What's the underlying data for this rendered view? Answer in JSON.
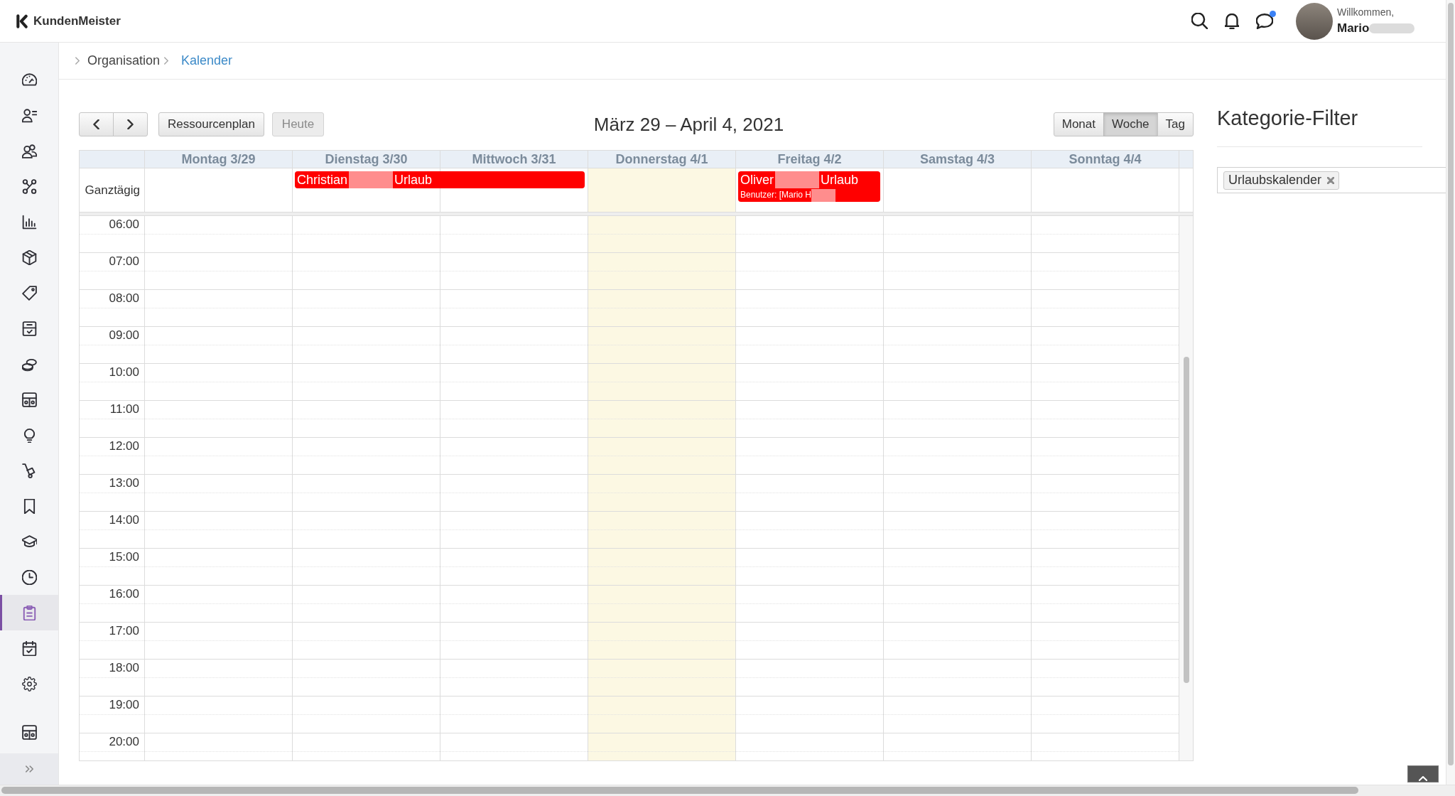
{
  "header": {
    "logo_text": "KundenMeister",
    "chat_unread": true,
    "user": {
      "greeting": "Willkommen,",
      "name": "Mario",
      "name_redacted": true
    }
  },
  "sidebar": {
    "items": [
      {
        "selected": false
      },
      {
        "selected": false
      },
      {
        "selected": false
      },
      {
        "selected": false
      },
      {
        "selected": false
      },
      {
        "selected": false
      },
      {
        "selected": false
      },
      {
        "selected": false
      },
      {
        "selected": false
      },
      {
        "selected": false
      },
      {
        "selected": false
      },
      {
        "selected": false
      },
      {
        "selected": false
      },
      {
        "selected": false
      },
      {
        "selected": false
      },
      {
        "selected": true
      },
      {
        "selected": false
      },
      {
        "selected": false
      }
    ]
  },
  "breadcrumb": [
    {
      "label": "Organisation",
      "current": false
    },
    {
      "label": "Kalender",
      "current": true
    }
  ],
  "toolbar": {
    "buttons": [
      {
        "label": "Ressourcenplan",
        "disabled": false
      },
      {
        "label": "Heute",
        "disabled": true
      }
    ],
    "title": "März 29 – April 4, 2021",
    "views": [
      {
        "label": "Monat",
        "selected": false
      },
      {
        "label": "Woche",
        "selected": true
      },
      {
        "label": "Tag",
        "selected": false
      }
    ]
  },
  "calendar": {
    "all_day_label": "Ganztägig",
    "days": [
      {
        "label": "Montag 3/29",
        "today": false
      },
      {
        "label": "Dienstag 3/30",
        "today": false,
        "all_day_events": [
          {
            "name": "Christian",
            "name_redacted": true,
            "category": "Urlaub",
            "continues_next_day": true
          }
        ]
      },
      {
        "label": "Mittwoch 3/31",
        "today": false
      },
      {
        "label": "Donnerstag 4/1",
        "today": true
      },
      {
        "label": "Freitag 4/2",
        "today": false,
        "all_day_events": [
          {
            "name": "Oliver",
            "name_redacted": true,
            "category": "Urlaub",
            "continues_next_day": false,
            "user": "Benutzer: [Mario H",
            "user_redacted": true
          }
        ]
      },
      {
        "label": "Samstag 4/3",
        "today": false
      },
      {
        "label": "Sonntag 4/4",
        "today": false
      }
    ],
    "hours": [
      "06:00",
      "07:00",
      "08:00",
      "09:00",
      "10:00",
      "11:00",
      "12:00",
      "13:00",
      "14:00",
      "15:00",
      "16:00",
      "17:00",
      "18:00",
      "19:00",
      "20:00"
    ]
  },
  "filter": {
    "title": "Kategorie-Filter",
    "tags": [
      {
        "label": "Urlaubskalender"
      }
    ]
  }
}
